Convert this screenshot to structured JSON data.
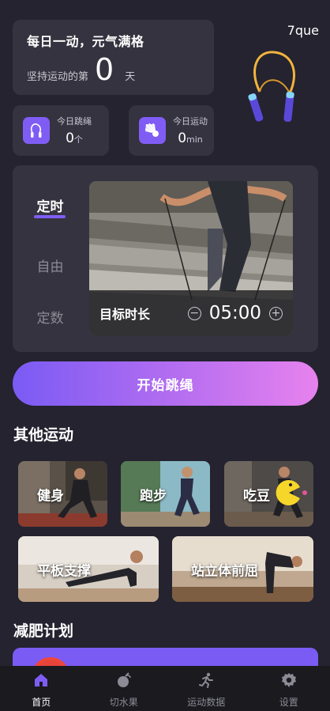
{
  "header": {
    "slogan": "每日一动，元气满格",
    "streak_prefix": "坚持运动的第",
    "streak_count": "0",
    "streak_unit": "天",
    "username": "7que"
  },
  "stats": [
    {
      "label": "今日跳绳",
      "value": "0",
      "unit": "个",
      "icon": "jump-rope-icon"
    },
    {
      "label": "今日运动",
      "value": "0",
      "unit": "min",
      "icon": "shuttlecock-icon"
    }
  ],
  "mode_tabs": [
    {
      "label": "定时",
      "active": true
    },
    {
      "label": "自由",
      "active": false
    },
    {
      "label": "定数",
      "active": false
    }
  ],
  "target": {
    "label": "目标时长",
    "value": "05:00",
    "minus_symbol": "−",
    "plus_symbol": "+"
  },
  "start_button": "开始跳绳",
  "other_sports_title": "其他运动",
  "sports": [
    {
      "label": "健身"
    },
    {
      "label": "跑步"
    },
    {
      "label": "吃豆"
    },
    {
      "label": "平板支撑"
    },
    {
      "label": "站立体前屈"
    }
  ],
  "plan_title": "减肥计划",
  "nav": [
    {
      "label": "首页",
      "icon": "home-icon",
      "active": true
    },
    {
      "label": "切水果",
      "icon": "fruit-icon",
      "active": false
    },
    {
      "label": "运动数据",
      "icon": "running-icon",
      "active": false
    },
    {
      "label": "设置",
      "icon": "gear-icon",
      "active": false
    }
  ],
  "colors": {
    "background": "#24232f",
    "card": "#34333f",
    "accent": "#7f5df5",
    "gradient_end": "#e782ee",
    "nav_background": "#1a1a1f"
  }
}
